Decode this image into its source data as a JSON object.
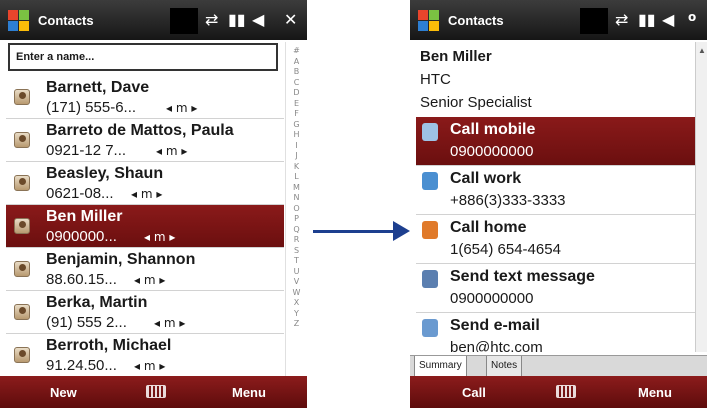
{
  "left": {
    "title": "Contacts",
    "search_placeholder": "Enter a name...",
    "alphabet": "#ABCDEFGHIJKLMNOPQRSTUVWXYZ",
    "contacts": [
      {
        "name": "Barnett, Dave",
        "number": "(171) 555-6...",
        "nav": "◂ m ▸",
        "selected": false
      },
      {
        "name": "Barreto de Mattos, Paula",
        "number": "0921-12 7...",
        "nav": "◂ m ▸",
        "selected": false
      },
      {
        "name": "Beasley, Shaun",
        "number": "0621-08...",
        "nav": "◂ m ▸",
        "selected": false
      },
      {
        "name": "Ben Miller",
        "number": "0900000...",
        "nav": "◂ m ▸",
        "selected": true
      },
      {
        "name": "Benjamin, Shannon",
        "number": "88.60.15...",
        "nav": "◂ m ▸",
        "selected": false
      },
      {
        "name": "Berka, Martin",
        "number": "(91) 555 2...",
        "nav": "◂ m ▸",
        "selected": false
      },
      {
        "name": "Berroth, Michael",
        "number": "91.24.50...",
        "nav": "◂ m ▸",
        "selected": false
      }
    ],
    "soft_left": "New",
    "soft_right": "Menu"
  },
  "right": {
    "title": "Contacts",
    "name": "Ben Miller",
    "company": "HTC",
    "job_title": "Senior Specialist",
    "actions": [
      {
        "label": "Call mobile",
        "value": "0900000000",
        "selected": true,
        "icon": "mobile-phone-icon",
        "icon_color": "#9ec3e6"
      },
      {
        "label": "Call work",
        "value": "+886(3)333-3333",
        "selected": false,
        "icon": "work-phone-icon",
        "icon_color": "#4a8fd1"
      },
      {
        "label": "Call home",
        "value": "1(654) 654-4654",
        "selected": false,
        "icon": "home-phone-icon",
        "icon_color": "#e07a2a"
      },
      {
        "label": "Send text message",
        "value": "0900000000",
        "selected": false,
        "icon": "text-message-icon",
        "icon_color": "#5b7fb0"
      },
      {
        "label": "Send e-mail",
        "value": "ben@htc.com",
        "selected": false,
        "icon": "email-icon",
        "icon_color": "#6a9ad0"
      }
    ],
    "tabs": [
      "Summary",
      "Notes"
    ],
    "soft_left": "Call",
    "soft_right": "Menu"
  },
  "colors": {
    "title_bar": "#1e1e1e",
    "selection": "#7a1414",
    "soft_keys": "#701414",
    "connector_arrow": "#1d3f8f"
  }
}
